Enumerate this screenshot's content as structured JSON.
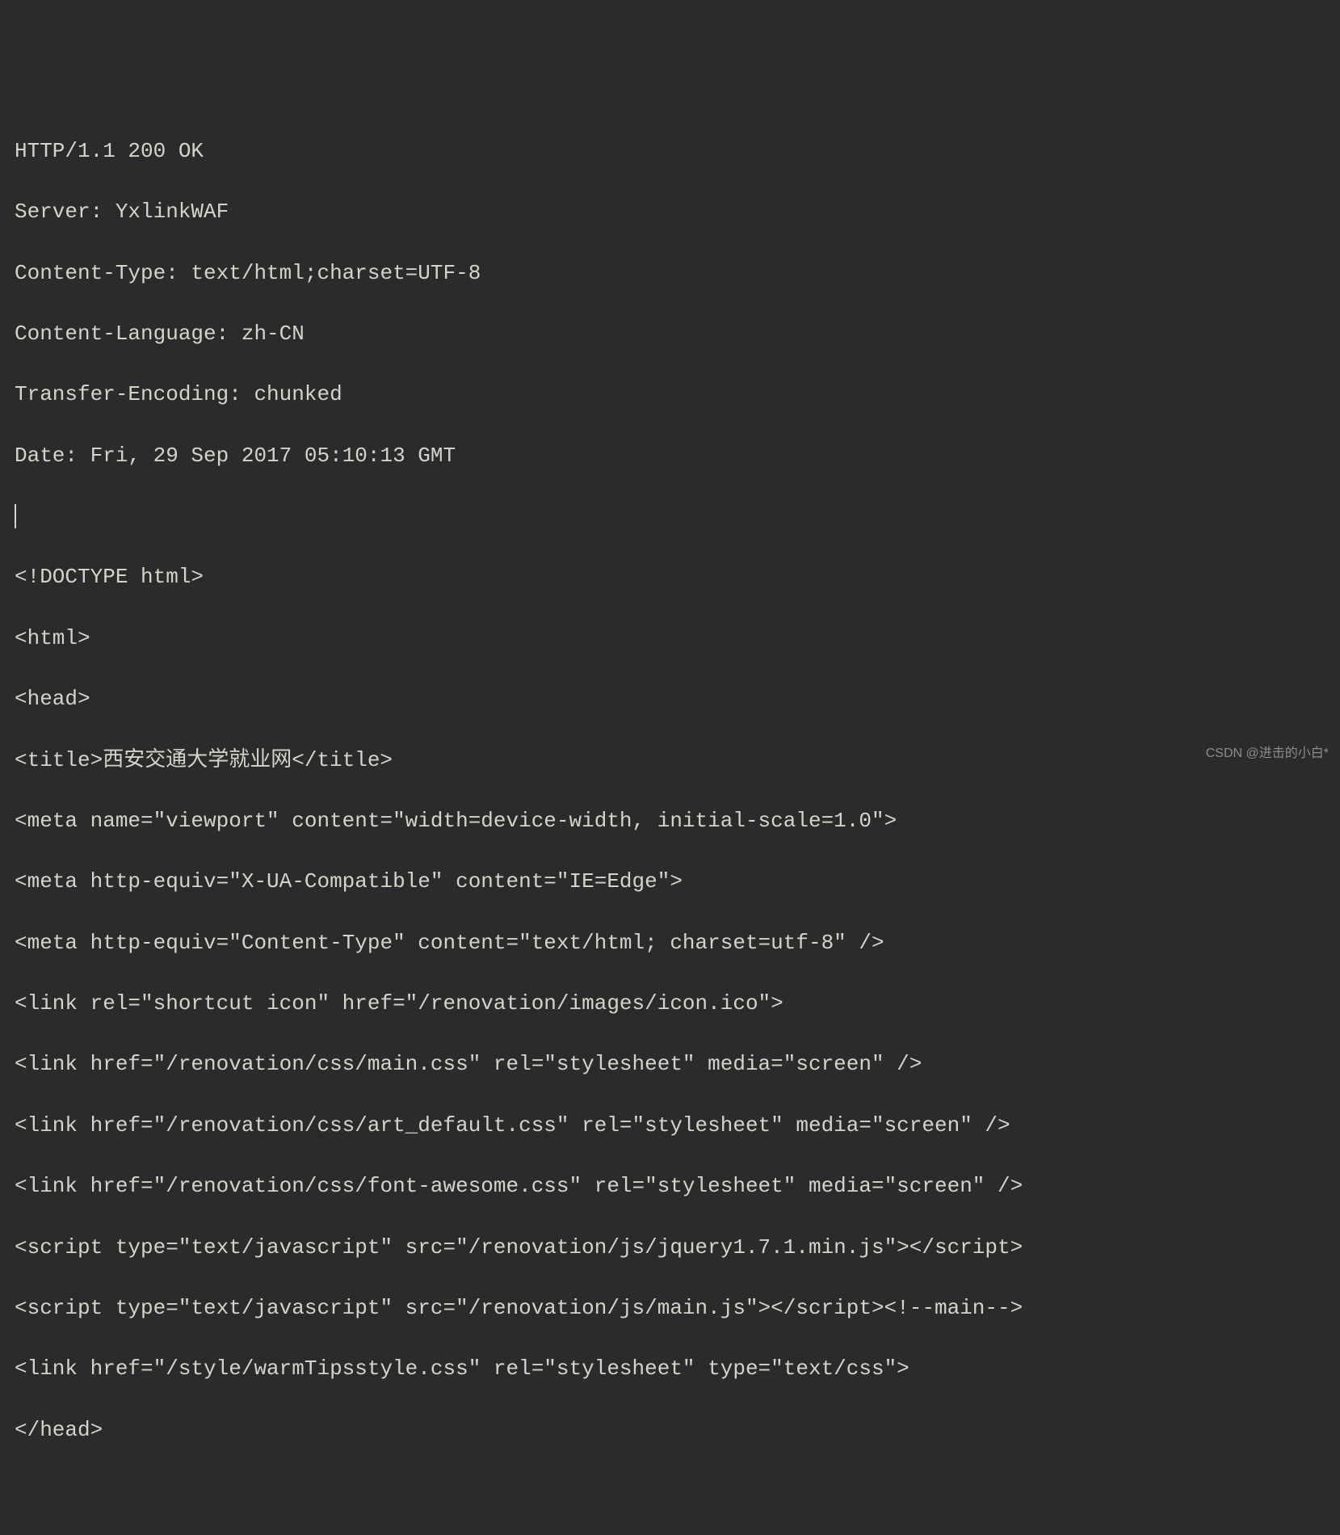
{
  "lines": {
    "l0": "HTTP/1.1 200 OK",
    "l1": "Server: YxlinkWAF",
    "l2": "Content-Type: text/html;charset=UTF-8",
    "l3": "Content-Language: zh-CN",
    "l4": "Transfer-Encoding: chunked",
    "l5": "Date: Fri, 29 Sep 2017 05:10:13 GMT",
    "l6": "",
    "l7": "<!DOCTYPE html>",
    "l8": "<html>",
    "l9": "<head>",
    "l10": "<title>西安交通大学就业网</title>",
    "l11": "<meta name=\"viewport\" content=\"width=device-width, initial-scale=1.0\">",
    "l12": "<meta http-equiv=\"X-UA-Compatible\" content=\"IE=Edge\">",
    "l13": "<meta http-equiv=\"Content-Type\" content=\"text/html; charset=utf-8\" />",
    "l14": "<link rel=\"shortcut icon\" href=\"/renovation/images/icon.ico\">",
    "l15": "<link href=\"/renovation/css/main.css\" rel=\"stylesheet\" media=\"screen\" />",
    "l16": "<link href=\"/renovation/css/art_default.css\" rel=\"stylesheet\" media=\"screen\" />",
    "l17": "<link href=\"/renovation/css/font-awesome.css\" rel=\"stylesheet\" media=\"screen\" />",
    "l18": "<script type=\"text/javascript\" src=\"/renovation/js/jquery1.7.1.min.js\"></script>",
    "l19": "<script type=\"text/javascript\" src=\"/renovation/js/main.js\"></script><!--main-->",
    "l20": "<link href=\"/style/warmTipsstyle.css\" rel=\"stylesheet\" type=\"text/css\">",
    "l21": "</head>"
  },
  "watermark": "CSDN @进击的小白*"
}
